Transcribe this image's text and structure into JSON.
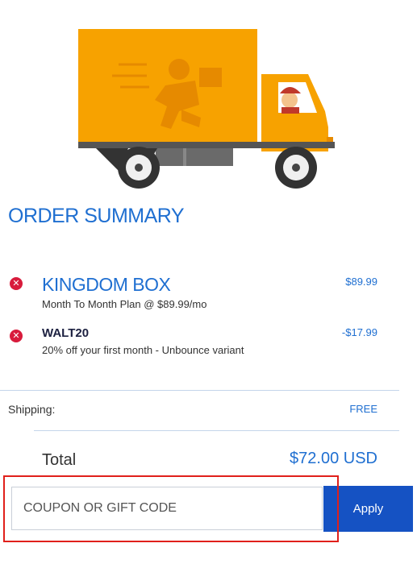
{
  "summary": {
    "title": "ORDER SUMMARY"
  },
  "items": [
    {
      "name": "KINGDOM BOX",
      "description": "Month To Month Plan @ $89.99/mo",
      "price": "$89.99"
    },
    {
      "name": "WALT20",
      "description": "20% off your first month - Unbounce variant",
      "price": "-$17.99"
    }
  ],
  "shipping": {
    "label": "Shipping:",
    "value": "FREE"
  },
  "total": {
    "label": "Total",
    "value": "$72.00 USD"
  },
  "coupon": {
    "placeholder": "COUPON OR GIFT CODE",
    "apply_label": "Apply"
  },
  "colors": {
    "accent": "#1f6fd1",
    "button": "#1552c3",
    "remove": "#d81b3c",
    "highlight": "#e0201b",
    "truck_body": "#f7a200"
  },
  "icons": {
    "remove": "remove-x-circle-icon",
    "hero": "delivery-truck-illustration"
  }
}
